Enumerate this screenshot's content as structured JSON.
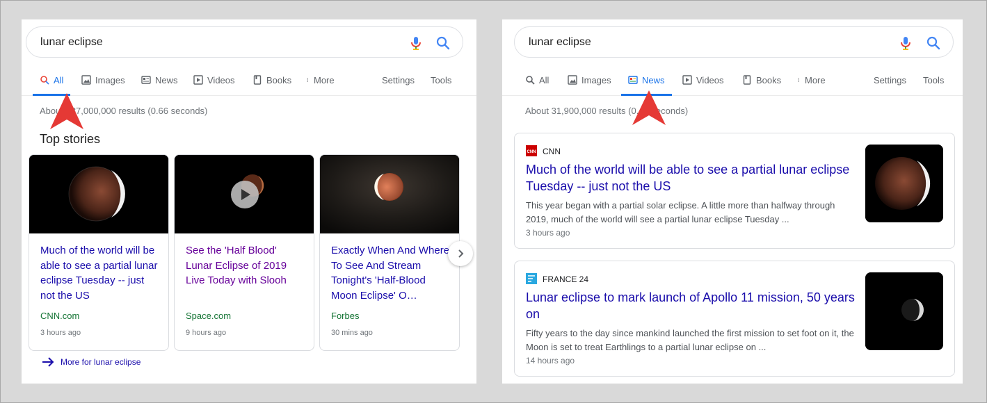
{
  "left": {
    "search": {
      "query": "lunar eclipse"
    },
    "tabs": {
      "all": "All",
      "images": "Images",
      "news": "News",
      "videos": "Videos",
      "books": "Books",
      "more": "More",
      "settings": "Settings",
      "tools": "Tools"
    },
    "stats": "About 187,000,000 results (0.66 seconds)",
    "top_stories": "Top stories",
    "stories": [
      {
        "title": "Much of the world will be able to see a partial lunar eclipse Tuesday -- just not the US",
        "source": "CNN.com",
        "time": "3 hours ago"
      },
      {
        "title": "See the 'Half Blood' Lunar Eclipse of 2019 Live Today with Slooh",
        "source": "Space.com",
        "time": "9 hours ago"
      },
      {
        "title": "Exactly When And Where To See And Stream Tonight's 'Half-Blood Moon Eclipse' O…",
        "source": "Forbes",
        "time": "30 mins ago"
      }
    ],
    "more_link": "More for lunar eclipse"
  },
  "right": {
    "search": {
      "query": "lunar eclipse"
    },
    "tabs": {
      "all": "All",
      "images": "Images",
      "news": "News",
      "videos": "Videos",
      "books": "Books",
      "more": "More",
      "settings": "Settings",
      "tools": "Tools"
    },
    "stats": "About 31,900,000 results (0.40 seconds)",
    "articles": [
      {
        "publisher": "CNN",
        "title": "Much of the world will be able to see a partial lunar eclipse Tuesday -- just not the US",
        "snippet": "This year began with a partial solar eclipse. A little more than halfway through 2019, much of the world will see a partial lunar eclipse Tuesday ...",
        "time": "3 hours ago"
      },
      {
        "publisher": "FRANCE 24",
        "title": "Lunar eclipse to mark launch of Apollo 11 mission, 50 years on",
        "snippet": "Fifty years to the day since mankind launched the first mission to set foot on it, the Moon is set to treat Earthlings to a partial lunar eclipse on ...",
        "time": "14 hours ago"
      }
    ]
  },
  "colors": {
    "link": "#1a0dab",
    "visited": "#660099",
    "source_green": "#137333",
    "active_tab": "#1a73e8",
    "arrow_red": "#e53935",
    "background": "#d9d9d9"
  },
  "icons": [
    "mic-icon",
    "search-icon",
    "image-icon",
    "newspaper-icon",
    "video-icon",
    "book-icon",
    "more-dots-icon",
    "play-icon",
    "chevron-right-icon",
    "arrow-right-icon",
    "red-pointer-arrow-icon"
  ]
}
